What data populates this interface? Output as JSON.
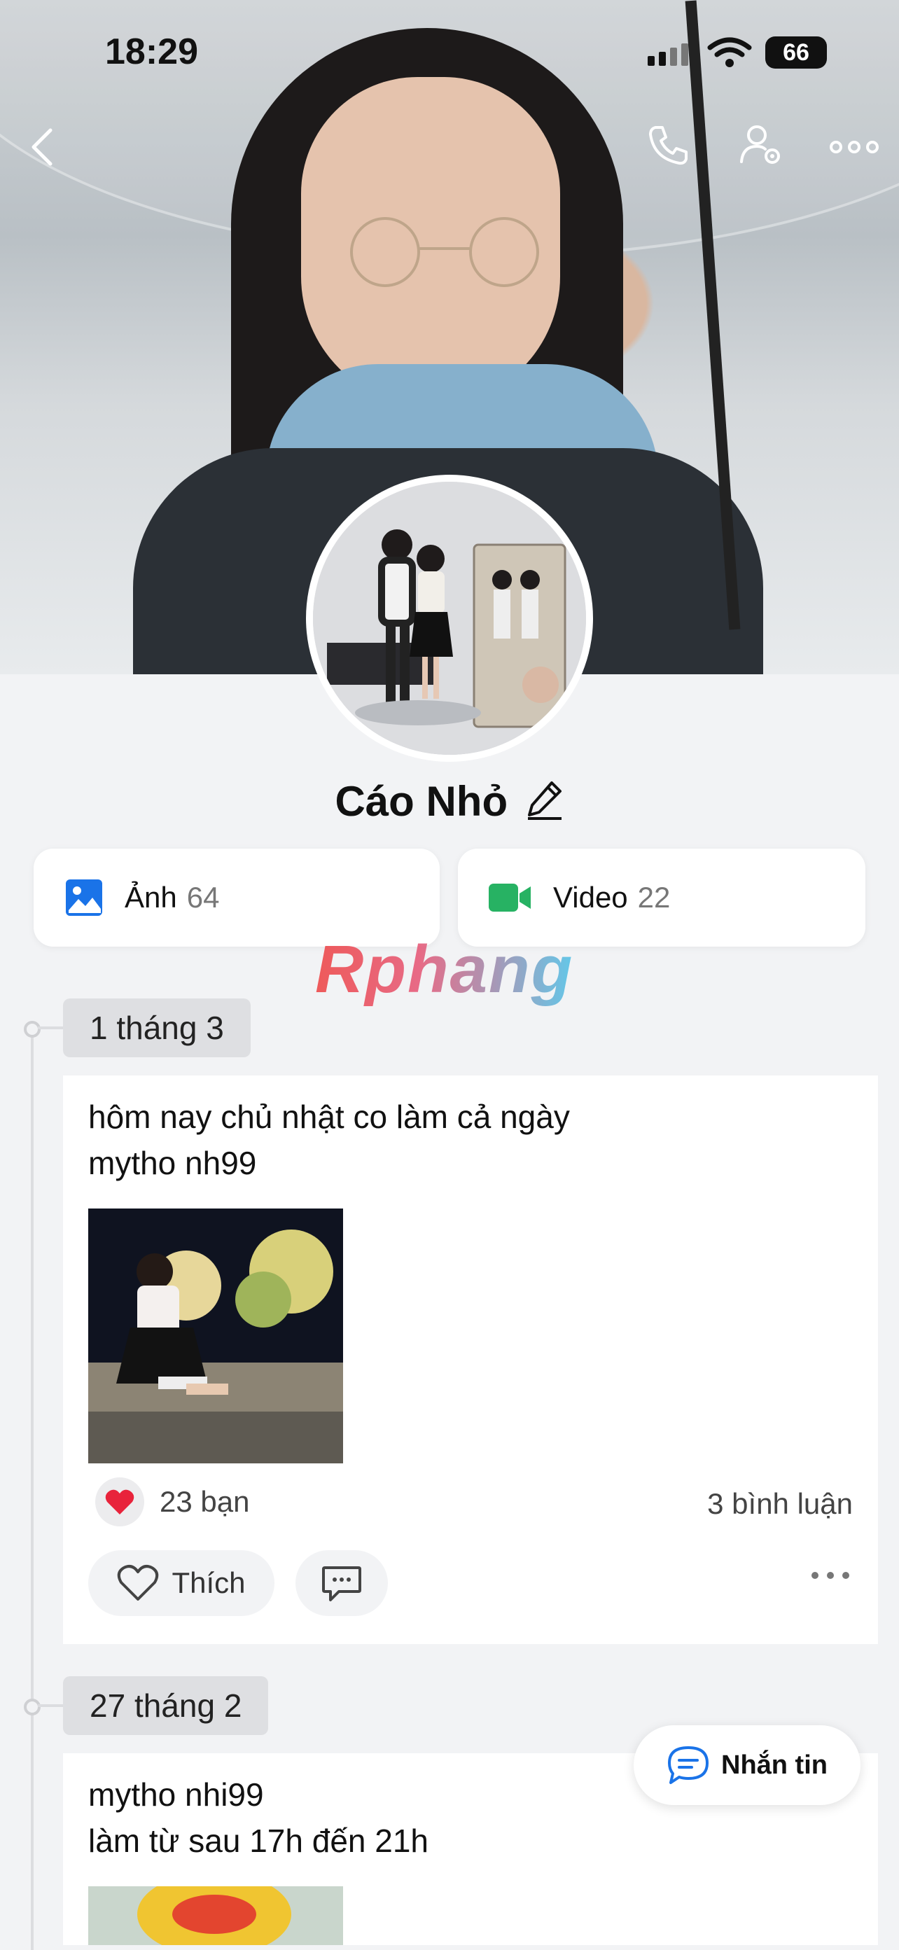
{
  "status_bar": {
    "time": "18:29",
    "battery": "66"
  },
  "profile": {
    "name": "Cáo Nhỏ"
  },
  "media": {
    "photos_label": "Ảnh",
    "photos_count": "64",
    "videos_label": "Video",
    "videos_count": "22"
  },
  "watermark": "Rphang",
  "posts": [
    {
      "date": "1 tháng 3",
      "text_line1": "hôm nay chủ nhật co làm cả ngày",
      "text_line2": "mytho nh99",
      "reaction_count": "23 bạn",
      "comment_count": "3 bình luận",
      "like_label": "Thích"
    },
    {
      "date": "27 tháng 2",
      "text_line1": "mytho nhi99",
      "text_line2": "làm từ sau 17h đến 21h"
    }
  ],
  "fab": {
    "label": "Nhắn tin"
  },
  "colors": {
    "accent_blue": "#1a73e8",
    "video_green": "#27b263",
    "heart_red": "#e8233b"
  }
}
